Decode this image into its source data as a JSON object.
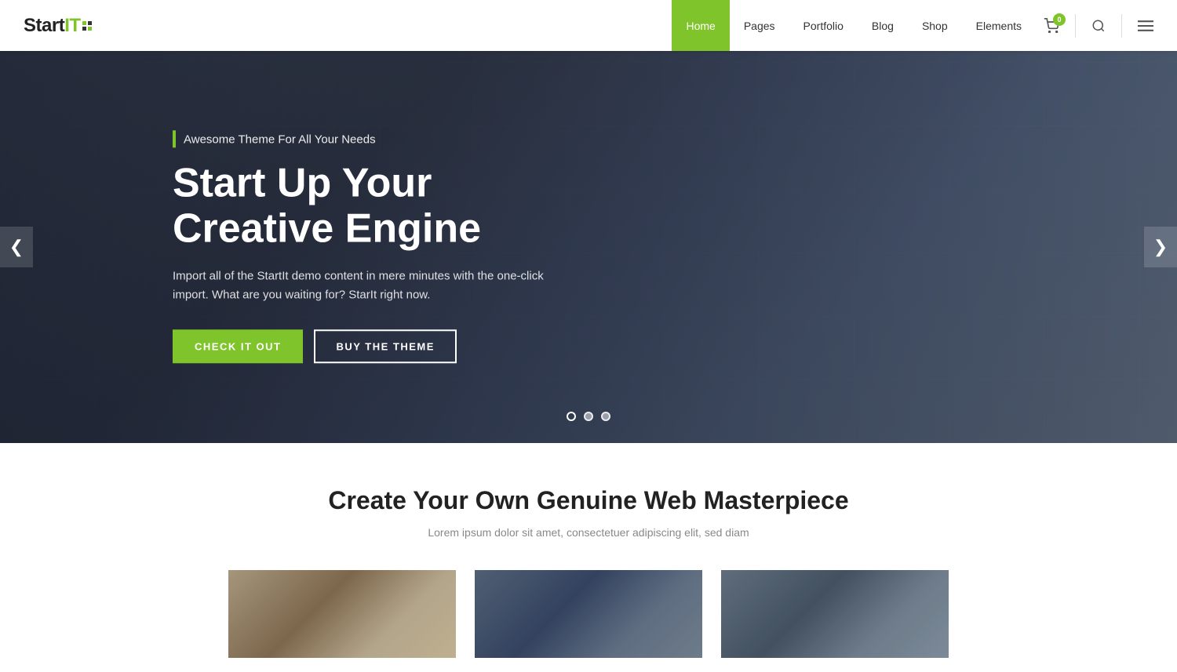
{
  "logo": {
    "brand": "Start",
    "it": "IT",
    "badge": "0"
  },
  "nav": {
    "items": [
      {
        "label": "Home",
        "active": true
      },
      {
        "label": "Pages",
        "active": false
      },
      {
        "label": "Portfolio",
        "active": false
      },
      {
        "label": "Blog",
        "active": false
      },
      {
        "label": "Shop",
        "active": false
      },
      {
        "label": "Elements",
        "active": false
      }
    ],
    "cart_count": "0"
  },
  "hero": {
    "subtitle": "Awesome Theme For All Your Needs",
    "title_line1": "Start Up Your",
    "title_line2": "Creative Engine",
    "description": "Import all of the StartIt demo content in mere minutes with the one-click import. What are you waiting for? StarIt right now.",
    "btn_primary": "CHECK IT OUT",
    "btn_secondary": "BUY THE THEME",
    "dots": [
      {
        "active": true
      },
      {
        "active": false
      },
      {
        "active": false
      }
    ],
    "arrow_left": "❮",
    "arrow_right": "❯"
  },
  "section": {
    "title": "Create Your Own Genuine Web Masterpiece",
    "subtitle": "Lorem ipsum dolor sit amet, consectetuer adipiscing elit, sed diam"
  },
  "cards": [
    {
      "id": 1
    },
    {
      "id": 2
    },
    {
      "id": 3
    }
  ]
}
